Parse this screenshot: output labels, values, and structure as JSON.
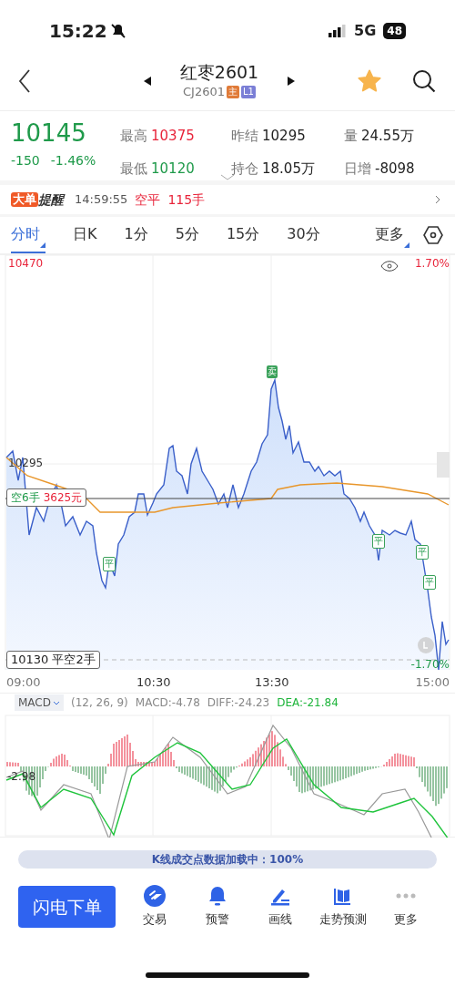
{
  "status_bar": {
    "time": "15:22",
    "network": "5G",
    "battery": "48"
  },
  "header": {
    "title": "红枣2601",
    "code": "CJ2601",
    "favorited": true,
    "badges": [
      {
        "text": "主",
        "color": "#e07b39"
      },
      {
        "text": "L1",
        "color": "#7b7fd6"
      }
    ]
  },
  "quote": {
    "price": "10145",
    "change": "-150",
    "change_pct": "-1.46%",
    "stats": [
      {
        "label": "最高",
        "value": "10375",
        "color": "#e8243a"
      },
      {
        "label": "昨结",
        "value": "10295",
        "color": "#222222"
      },
      {
        "label": "量",
        "value": "24.55万",
        "color": "#222222"
      },
      {
        "label": "最低",
        "value": "10120",
        "color": "#1f9a4a"
      },
      {
        "label": "持仓",
        "value": "18.05万",
        "color": "#222222"
      },
      {
        "label": "日增",
        "value": "-8098",
        "color": "#222222"
      }
    ]
  },
  "alert": {
    "tag": "大单",
    "title": "提醒",
    "time": "14:59:55",
    "action": "空平",
    "volume": "115手"
  },
  "tabs": [
    {
      "label": "分时",
      "selected": true,
      "dropdown": true
    },
    {
      "label": "日K",
      "selected": false,
      "dropdown": false
    },
    {
      "label": "1分",
      "selected": false,
      "dropdown": false
    },
    {
      "label": "5分",
      "selected": false,
      "dropdown": false
    },
    {
      "label": "15分",
      "selected": false,
      "dropdown": false
    },
    {
      "label": "30分",
      "selected": false,
      "dropdown": false
    },
    {
      "label": "更多",
      "selected": false,
      "dropdown": true
    }
  ],
  "chart": {
    "price_high": "10470",
    "pct_high": "1.70%",
    "prev_settle": "10295",
    "position": {
      "side": "空6手",
      "pnl": "3625元"
    },
    "trade_label": "10130 平空2手",
    "pct_low": "-1.70%",
    "markers": [
      {
        "text": "卖",
        "kind": "sell"
      },
      {
        "text": "平",
        "kind": "close"
      },
      {
        "text": "平",
        "kind": "close"
      },
      {
        "text": "平",
        "kind": "close"
      },
      {
        "text": "平",
        "kind": "close"
      }
    ],
    "time_axis": [
      "09:00",
      "10:30",
      "13:30",
      "15:00"
    ]
  },
  "indicator": {
    "name": "MACD",
    "params": "(12, 26, 9)",
    "macd": "MACD:-4.78",
    "diff": "DIFF:-24.23",
    "dea": "DEA:-21.84",
    "zero_label": "-2.98"
  },
  "loading": {
    "text": "K线成交点数据加载中：100%"
  },
  "bottom_bar": {
    "primary": "闪电下单",
    "actions": [
      {
        "label": "交易",
        "kind": "trade"
      },
      {
        "label": "预警",
        "kind": "bell"
      },
      {
        "label": "画线",
        "kind": "draw"
      },
      {
        "label": "走势预测",
        "kind": "book"
      },
      {
        "label": "更多",
        "kind": "more"
      }
    ]
  }
}
